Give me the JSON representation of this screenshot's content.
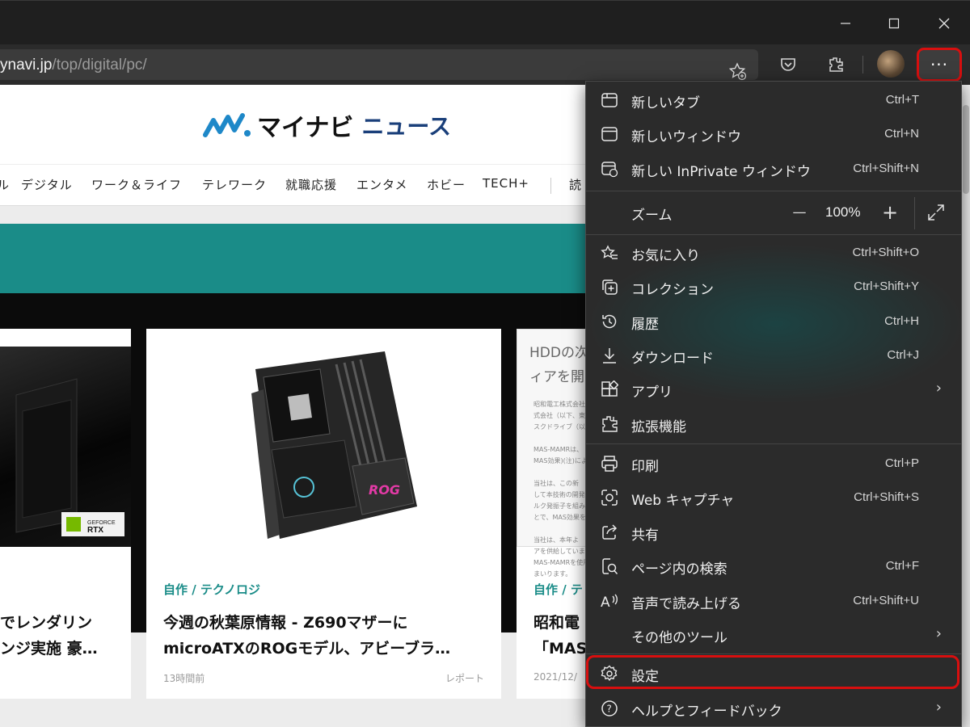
{
  "window": {
    "minimize_glyph": "—",
    "maximize_glyph": "☐",
    "close_glyph": "✕"
  },
  "toolbar": {
    "url_host": "ynavi.jp",
    "url_path": "/top/digital/pc/",
    "more_label": "···"
  },
  "site": {
    "logo_name": "マイナビ",
    "logo_news": "ニュース",
    "nav": [
      "ル",
      "デジタル",
      "ワーク＆ライフ",
      "テレワーク",
      "就職応援",
      "エンタメ",
      "ホビー",
      "TECH+",
      "読"
    ]
  },
  "cards": [
    {
      "title_line1": "でレンダリン",
      "title_line2": "ンジ実施 豪…"
    },
    {
      "category": "自作 / テクノロジ",
      "title_line1": "今週の秋葉原情報 - Z690マザーに",
      "title_line2": "microATXのROGモデル、アビーブラ…",
      "time": "13時間前",
      "tag": "レポート"
    },
    {
      "image_line1": "HDDの次",
      "image_line2": "ィアを開",
      "image_body": "昭和電工株式会社\n式会社（以下、東\nスクドライブ（以\n\nMAS-MAMRは、\nMAS効果)(注)により\n\n当社は、この新\nして本技術の開発\nルク発振子を組み\nとで、MAS効果を\n\n当社は、本年よ\nアを供給しています\nMAS-MAMRを使用\nまいります。",
      "category": "自作 / テ",
      "title_line1": "昭和電",
      "title_line2": "「MAS",
      "time": "2021/12/"
    }
  ],
  "menu": {
    "items": [
      {
        "label": "新しいタブ",
        "shortcut": "Ctrl+T",
        "icon": "new-tab-icon"
      },
      {
        "label": "新しいウィンドウ",
        "shortcut": "Ctrl+N",
        "icon": "new-window-icon"
      },
      {
        "label": "新しい InPrivate ウィンドウ",
        "shortcut": "Ctrl+Shift+N",
        "icon": "inprivate-icon"
      },
      {
        "label": "お気に入り",
        "shortcut": "Ctrl+Shift+O",
        "icon": "favorites-icon"
      },
      {
        "label": "コレクション",
        "shortcut": "Ctrl+Shift+Y",
        "icon": "collections-icon"
      },
      {
        "label": "履歴",
        "shortcut": "Ctrl+H",
        "icon": "history-icon"
      },
      {
        "label": "ダウンロード",
        "shortcut": "Ctrl+J",
        "icon": "download-icon"
      },
      {
        "label": "アプリ",
        "shortcut": "",
        "icon": "apps-icon"
      },
      {
        "label": "拡張機能",
        "shortcut": "",
        "icon": "extensions-icon"
      },
      {
        "label": "印刷",
        "shortcut": "Ctrl+P",
        "icon": "print-icon"
      },
      {
        "label": "Web キャプチャ",
        "shortcut": "Ctrl+Shift+S",
        "icon": "web-capture-icon"
      },
      {
        "label": "共有",
        "shortcut": "",
        "icon": "share-icon"
      },
      {
        "label": "ページ内の検索",
        "shortcut": "Ctrl+F",
        "icon": "find-icon"
      },
      {
        "label": "音声で読み上げる",
        "shortcut": "Ctrl+Shift+U",
        "icon": "read-aloud-icon"
      },
      {
        "label": "その他のツール",
        "shortcut": "",
        "icon": ""
      },
      {
        "label": "設定",
        "shortcut": "",
        "icon": "settings-icon"
      },
      {
        "label": "ヘルプとフィードバック",
        "shortcut": "",
        "icon": "help-icon"
      }
    ],
    "zoom": {
      "label": "ズーム",
      "value": "100%",
      "minus": "—",
      "plus": "+"
    },
    "chevron": "›"
  },
  "colors": {
    "accent_red": "#d80f0f",
    "menu_bg": "#2b2b2b",
    "teal": "#1a8c88"
  }
}
